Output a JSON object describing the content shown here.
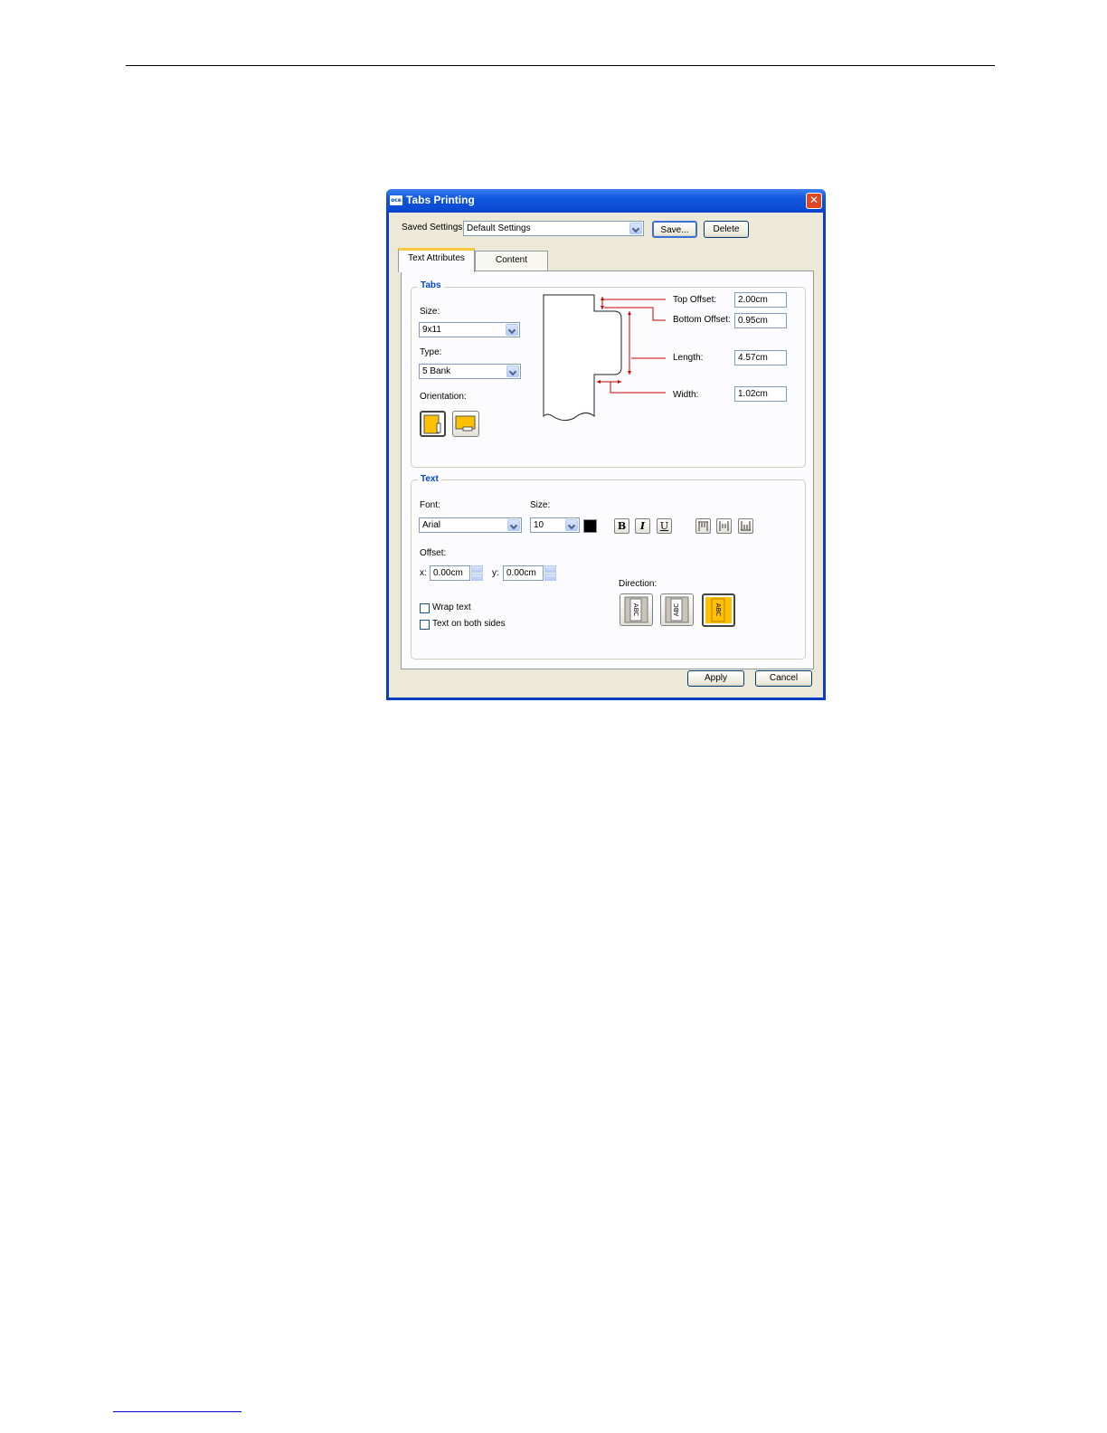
{
  "dialog": {
    "logo_text": "oce",
    "title": "Tabs Printing",
    "close_glyph": "✕",
    "saved_settings_label": "Saved Settings:",
    "saved_settings_value": "Default Settings",
    "save_button": "Save...",
    "delete_button": "Delete",
    "tabs": [
      "Text Attributes",
      "Content"
    ],
    "apply_button": "Apply",
    "cancel_button": "Cancel"
  },
  "tabs_group": {
    "title": "Tabs",
    "size_label": "Size:",
    "size_value": "9x11",
    "type_label": "Type:",
    "type_value": "5 Bank",
    "orientation_label": "Orientation:",
    "top_offset_label": "Top Offset:",
    "top_offset_value": "2.00cm",
    "bottom_offset_label": "Bottom Offset:",
    "bottom_offset_value": "0.95cm",
    "length_label": "Length:",
    "length_value": "4.57cm",
    "width_label": "Width:",
    "width_value": "1.02cm"
  },
  "text_group": {
    "title": "Text",
    "font_label": "Font:",
    "font_value": "Arial",
    "size_label": "Size:",
    "size_value": "10",
    "bold": "B",
    "italic": "I",
    "underline": "U",
    "offset_label": "Offset:",
    "x_label": "x:",
    "x_value": "0.00cm",
    "y_label": "y:",
    "y_value": "0.00cm",
    "wrap_text_label": "Wrap text",
    "both_sides_label": "Text on both sides",
    "direction_label": "Direction:",
    "direction_sample": "ABC"
  },
  "colors": {
    "accent_yellow": "#ffc000",
    "title_blue": "#0a46cf",
    "diagram_red": "#cc0000"
  }
}
